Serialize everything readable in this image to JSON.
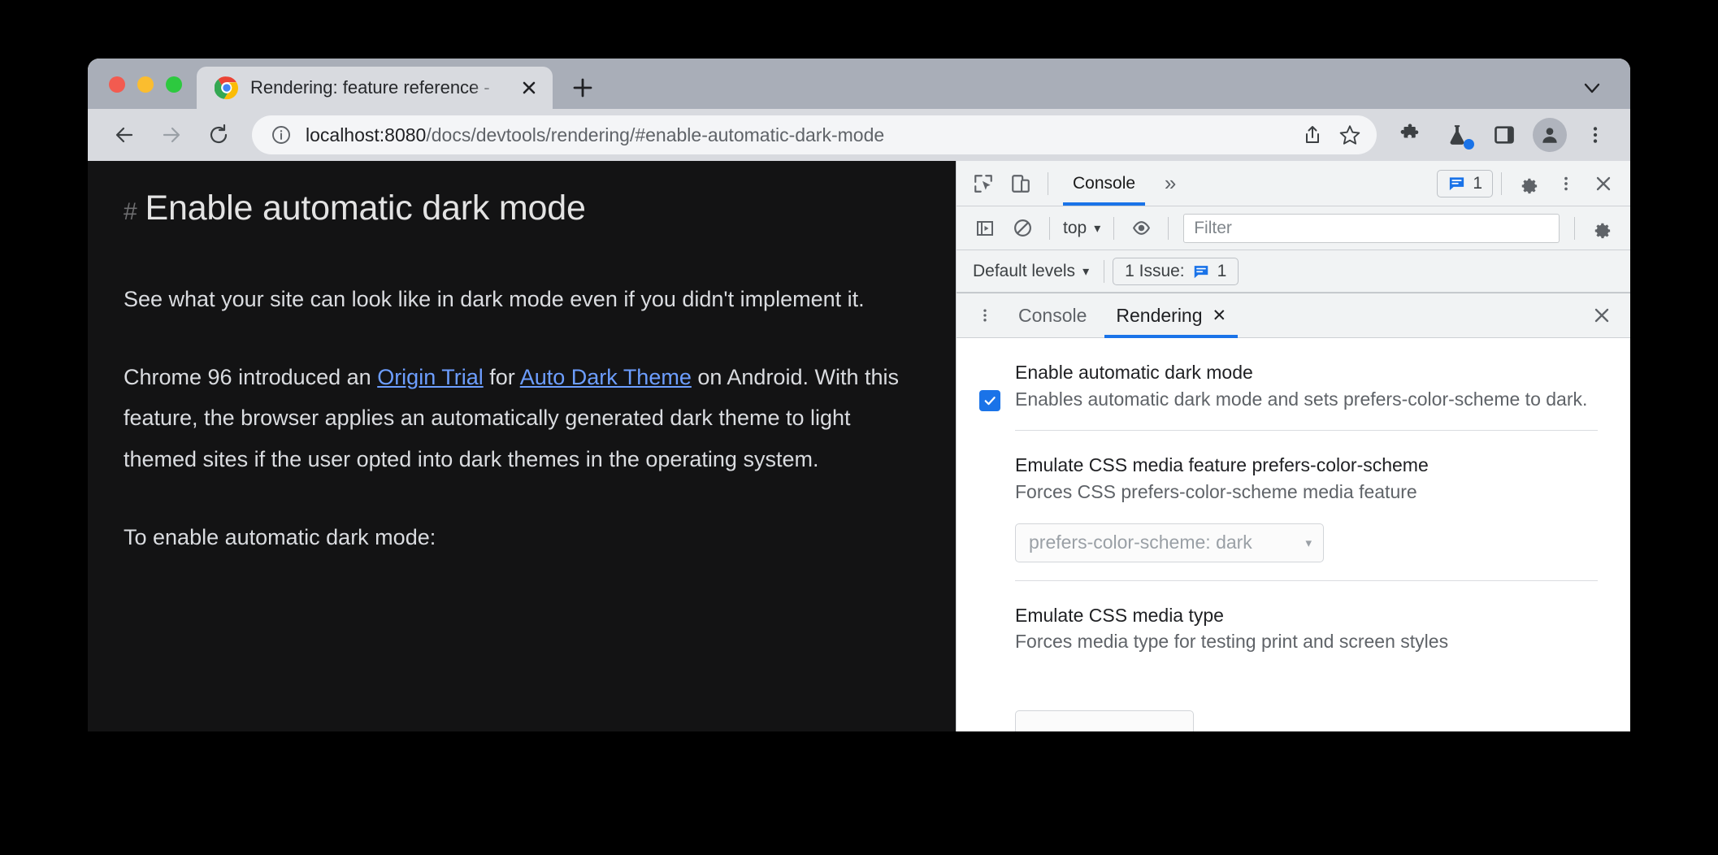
{
  "browser": {
    "tab": {
      "title": "Rendering: feature reference -",
      "favicon": "chrome-logo-icon",
      "close_label": "✕"
    },
    "new_tab_label": "+",
    "tabstrip_chevron": "⌄",
    "toolbar": {
      "back": "←",
      "forward": "→",
      "reload": "⟳",
      "url_host": "localhost:8080",
      "url_path": "/docs/devtools/rendering/#enable-automatic-dark-mode",
      "url_full": "localhost:8080/docs/devtools/rendering/#enable-automatic-dark-mode",
      "icons": [
        "share-icon",
        "bookmark-star-icon",
        "extensions-puzzle-icon",
        "experiments-flask-icon",
        "side-panel-icon",
        "profile-avatar",
        "chrome-menu-icon"
      ]
    }
  },
  "page": {
    "heading": "Enable automatic dark mode",
    "hash_anchor": "#",
    "paragraph1": "See what your site can look like in dark mode even if you didn't implement it.",
    "paragraph2": {
      "part1": "Chrome 96 introduced an ",
      "link1": "Origin Trial",
      "part2": " for ",
      "link2": "Auto Dark Theme",
      "part3": " on Android. With this feature, the browser applies an automatically generated dark theme to light themed sites if the user opted into dark themes in the operating system."
    },
    "paragraph3": "To enable automatic dark mode:",
    "colors": {
      "background": "#131314",
      "text": "#dadce0",
      "link": "#6d9eff"
    }
  },
  "devtools": {
    "main_tabbar": {
      "inspect_icon": "inspect-element-icon",
      "device_icon": "device-toolbar-icon",
      "tabs": [
        {
          "label": "Console",
          "active": true
        }
      ],
      "more_tabs_label": "»",
      "messages_count": "1",
      "settings_icon": "gear-icon",
      "menu_icon": "three-dot-menu-icon",
      "close_icon": "close-icon"
    },
    "console_toolbar": {
      "sidebar_icon": "console-sidebar-icon",
      "clear_icon": "clear-console-icon",
      "context_label": "top",
      "context_caret": "▾",
      "eye_icon": "live-expression-eye-icon",
      "filter_placeholder": "Filter",
      "settings_icon": "gear-icon"
    },
    "levels_row": {
      "levels_label": "Default levels",
      "levels_caret": "▾",
      "issue_label": "1 Issue:",
      "issue_count": "1"
    },
    "drawer": {
      "menu_icon": "three-dot-menu-icon",
      "tabs": [
        {
          "label": "Console",
          "active": false,
          "closable": false
        },
        {
          "label": "Rendering",
          "active": true,
          "closable": true,
          "close_label": "✕"
        }
      ],
      "close_icon": "close-icon"
    },
    "rendering_settings": [
      {
        "title": "Enable automatic dark mode",
        "description": "Enables automatic dark mode and sets prefers-color-scheme to dark.",
        "checkbox": true,
        "check_glyph": "✓"
      },
      {
        "title": "Emulate CSS media feature prefers-color-scheme",
        "description": "Forces CSS prefers-color-scheme media feature",
        "select_value": "prefers-color-scheme: dark",
        "select_caret": "▾"
      },
      {
        "title": "Emulate CSS media type",
        "description": "Forces media type for testing print and screen styles"
      }
    ],
    "accent_color": "#1a73e8"
  }
}
